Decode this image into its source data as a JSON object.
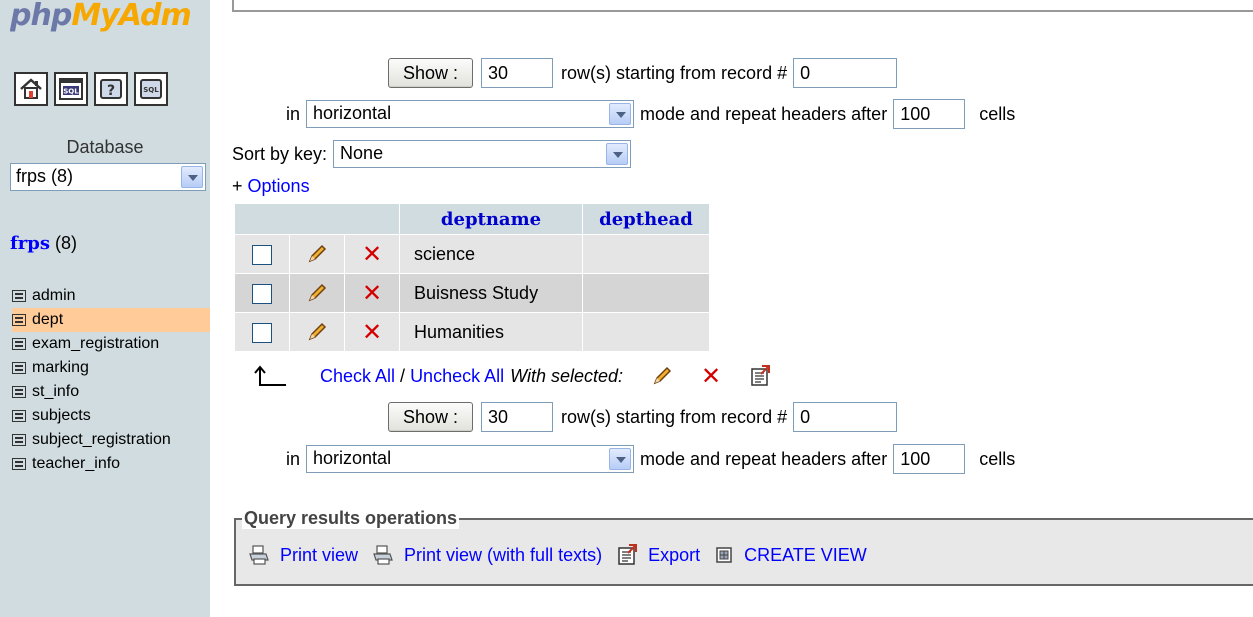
{
  "logo": {
    "part1": "php",
    "part2": "MyAdm"
  },
  "nav": {
    "icons": [
      "home-icon",
      "sql-query-icon",
      "help-docs-icon",
      "sql-docs-icon"
    ],
    "database_label": "Database",
    "database_selected": "frps (8)",
    "db_name": "frps",
    "db_count": "(8)",
    "tables": [
      {
        "label": "admin",
        "active": false
      },
      {
        "label": "dept",
        "active": true
      },
      {
        "label": "exam_registration",
        "active": false
      },
      {
        "label": "marking",
        "active": false
      },
      {
        "label": "st_info",
        "active": false
      },
      {
        "label": "subjects",
        "active": false
      },
      {
        "label": "subject_registration",
        "active": false
      },
      {
        "label": "teacher_info",
        "active": false
      }
    ]
  },
  "nav_top": {
    "show_label": "Show :",
    "rows_value": "30",
    "rows_text": "row(s) starting from record #",
    "start_value": "0",
    "in_text": "in",
    "mode_value": "horizontal",
    "mode_text": "mode and repeat headers after",
    "repeat_value": "100",
    "cells_text": "cells"
  },
  "sort": {
    "label": "Sort by key:",
    "value": "None"
  },
  "options": {
    "plus": "+",
    "label": "Options"
  },
  "table": {
    "columns": [
      "deptname",
      "depthead"
    ],
    "rows": [
      {
        "deptname": "science",
        "depthead": ""
      },
      {
        "deptname": "Buisness Study",
        "depthead": ""
      },
      {
        "deptname": "Humanities",
        "depthead": ""
      }
    ]
  },
  "checkall": {
    "check_all": "Check All",
    "separator": " / ",
    "uncheck_all": "Uncheck All",
    "with_selected": "With selected:"
  },
  "nav_bottom": {
    "show_label": "Show :",
    "rows_value": "30",
    "rows_text": "row(s) starting from record #",
    "start_value": "0",
    "in_text": "in",
    "mode_value": "horizontal",
    "mode_text": "mode and repeat headers after",
    "repeat_value": "100",
    "cells_text": "cells"
  },
  "query_ops": {
    "legend": "Query results operations",
    "print_view": "Print view",
    "print_view_full": "Print view (with full texts)",
    "export": "Export",
    "create_view": "CREATE VIEW"
  },
  "colors": {
    "nav_bg": "#d0dce0",
    "active_row": "#ffcc99",
    "link": "#0000ff",
    "delete": "#d40000"
  }
}
